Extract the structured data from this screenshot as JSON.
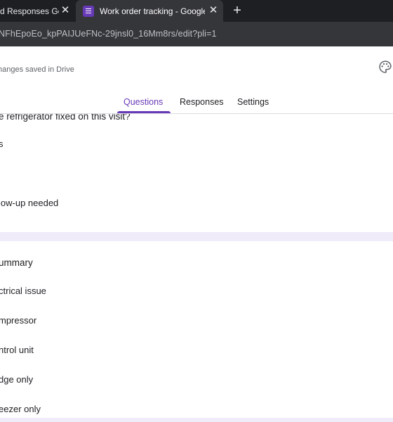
{
  "browser": {
    "tabs": [
      {
        "title": "d Responses Goo",
        "active": false
      },
      {
        "title": "Work order tracking - Google Forms",
        "active": true
      }
    ],
    "new_tab_label": "+",
    "close_label": "✕",
    "url": "NFhEpoEo_kpPAIJUeFNc-29jnsl0_16Mm8rs/edit?pli=1"
  },
  "header": {
    "save_status": "hanges saved in Drive",
    "nav_tabs": [
      {
        "label": "Questions",
        "active": true
      },
      {
        "label": "Responses",
        "active": false
      },
      {
        "label": "Settings",
        "active": false
      }
    ]
  },
  "questions": [
    {
      "title": "e refrigerator fixed on this visit?",
      "options": [
        "s",
        "low-up needed"
      ]
    },
    {
      "title": "ummary",
      "options": [
        "ctrical issue",
        "mpressor",
        "ntrol unit",
        "dge only",
        "eezer only"
      ]
    }
  ],
  "colors": {
    "accent": "#673ab7",
    "tabbar": "#1e1f22",
    "toolbar": "#35363a",
    "content_bg": "#f0ebf8"
  }
}
